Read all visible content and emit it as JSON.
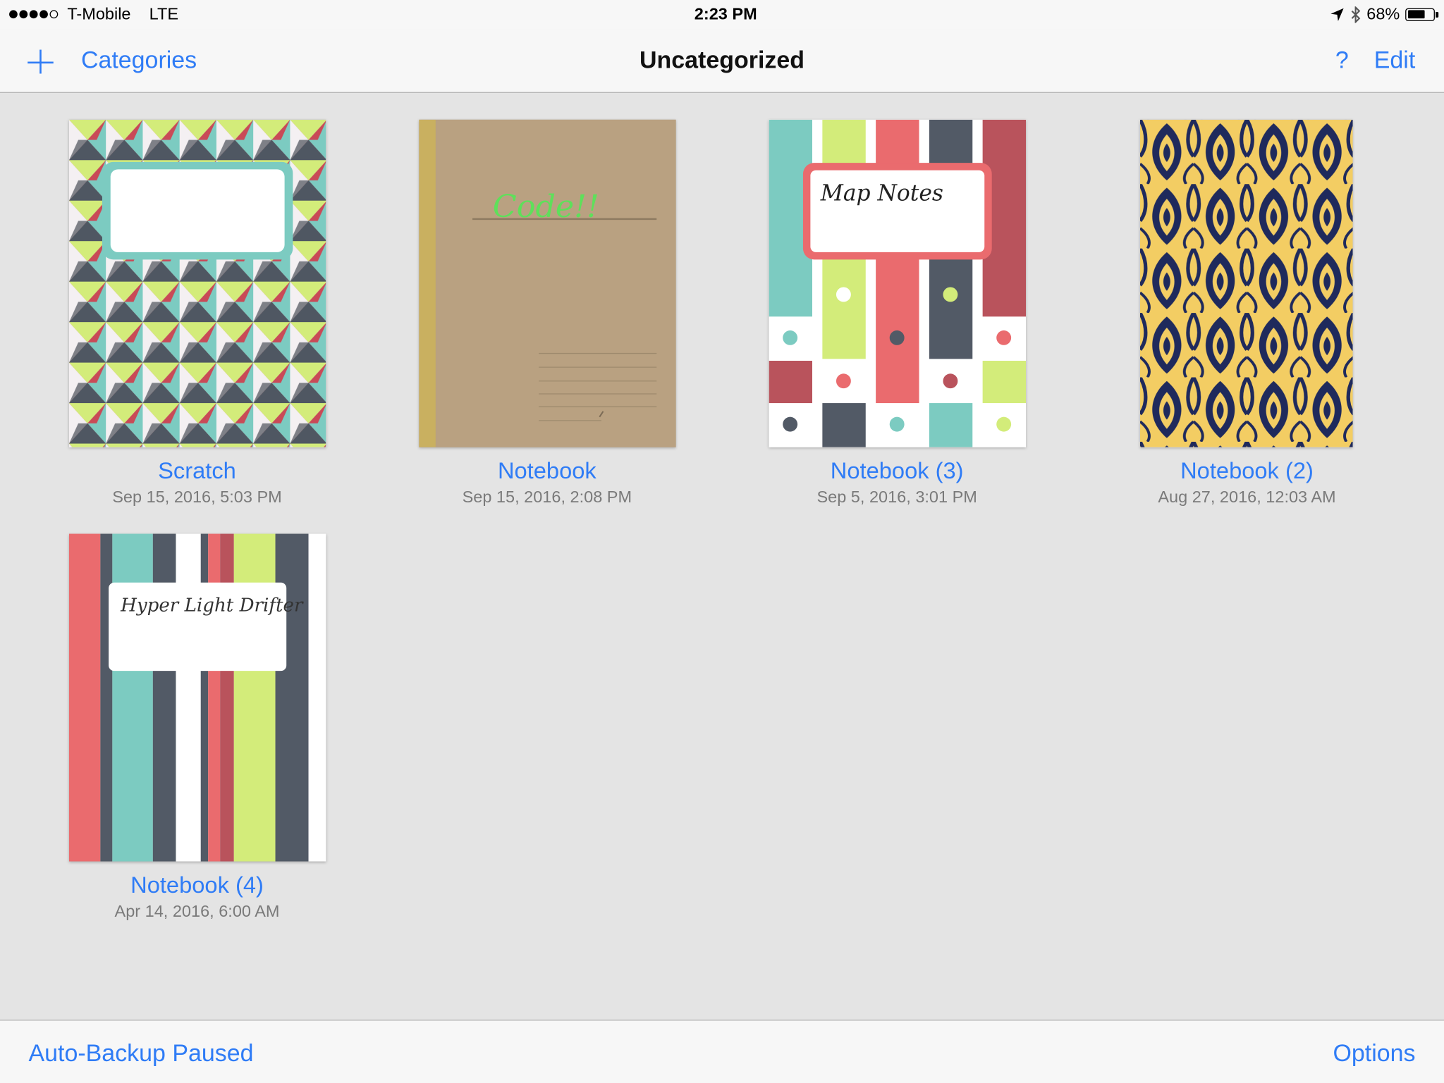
{
  "status_bar": {
    "carrier": "T-Mobile",
    "network": "LTE",
    "time": "2:23 PM",
    "battery": "68%",
    "battery_level": 0.68,
    "location_icon": "location-arrow-icon",
    "bluetooth_icon": "bluetooth-icon"
  },
  "nav": {
    "add_icon": "plus-icon",
    "categories_label": "Categories",
    "title": "Uncategorized",
    "help_label": "?",
    "edit_label": "Edit",
    "accent_color": "#2f7cf6"
  },
  "notebooks": [
    {
      "title": "Scratch",
      "date": "Sep 15, 2016, 5:03 PM",
      "cover": "geometric-triangles-cover"
    },
    {
      "title": "Notebook",
      "date": "Sep 15, 2016, 2:08 PM",
      "cover": "kraft-paper-cover",
      "label": "Code!!"
    },
    {
      "title": "Notebook (3)",
      "date": "Sep 5, 2016, 3:01 PM",
      "cover": "color-stripes-dots-cover",
      "label": "Map Notes"
    },
    {
      "title": "Notebook (2)",
      "date": "Aug 27, 2016, 12:03 AM",
      "cover": "art-nouveau-yellow-navy-cover"
    },
    {
      "title": "Notebook (4)",
      "date": "Apr 14, 2016, 6:00 AM",
      "cover": "vertical-stripes-cover",
      "label": "Hyper Light Drifter"
    }
  ],
  "bottom": {
    "backup_label": "Auto-Backup Paused",
    "options_label": "Options"
  }
}
